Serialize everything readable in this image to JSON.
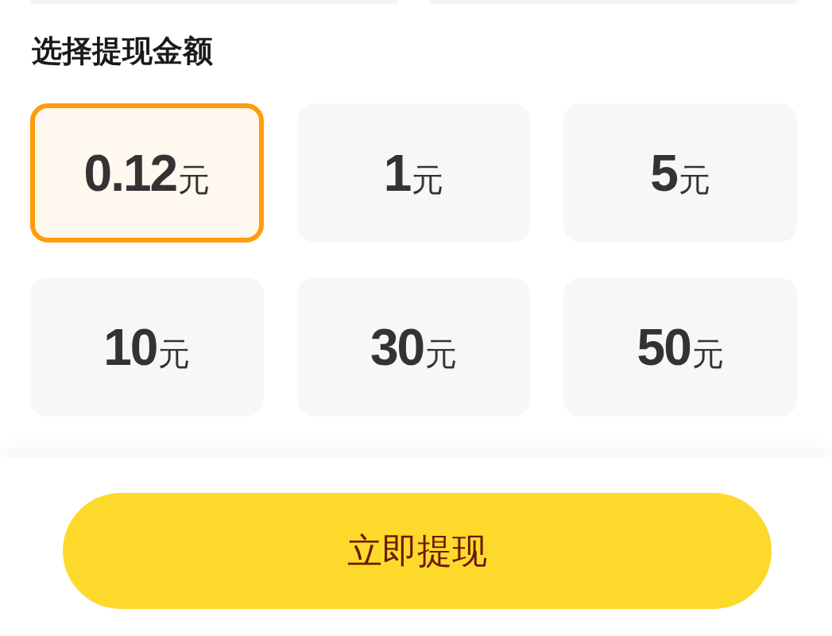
{
  "section": {
    "title": "选择提现金额"
  },
  "amounts": [
    {
      "value": "0.12",
      "unit": "元",
      "selected": true
    },
    {
      "value": "1",
      "unit": "元",
      "selected": false
    },
    {
      "value": "5",
      "unit": "元",
      "selected": false
    },
    {
      "value": "10",
      "unit": "元",
      "selected": false
    },
    {
      "value": "30",
      "unit": "元",
      "selected": false
    },
    {
      "value": "50",
      "unit": "元",
      "selected": false
    }
  ],
  "submit_button": {
    "label": "立即提现"
  }
}
